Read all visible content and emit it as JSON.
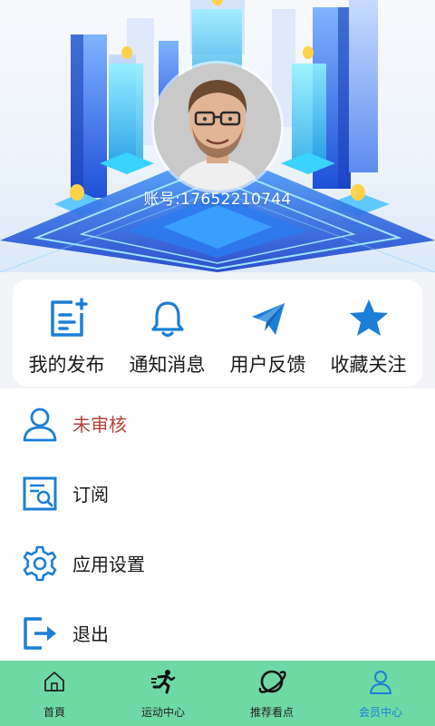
{
  "profile": {
    "account_text": "账号:17652210744"
  },
  "quick_actions": [
    {
      "label": "我的发布",
      "icon": "edit-document-icon"
    },
    {
      "label": "通知消息",
      "icon": "bell-icon"
    },
    {
      "label": "用户反馈",
      "icon": "paper-plane-icon"
    },
    {
      "label": "收藏关注",
      "icon": "star-icon"
    }
  ],
  "menu": [
    {
      "label": "未审核",
      "icon": "user-icon",
      "status": true
    },
    {
      "label": "订阅",
      "icon": "search-document-icon"
    },
    {
      "label": "应用设置",
      "icon": "gear-icon"
    },
    {
      "label": "退出",
      "icon": "logout-icon"
    }
  ],
  "tabs": [
    {
      "label": "首頁",
      "icon": "home-icon"
    },
    {
      "label": "运动中心",
      "icon": "runner-icon"
    },
    {
      "label": "推荐看点",
      "icon": "planet-icon"
    },
    {
      "label": "会员中心",
      "icon": "member-icon",
      "active": true
    }
  ],
  "colors": {
    "accent_blue": "#1b7fd6",
    "status_red": "#b5443a",
    "tabbar_green": "#6fd9a5"
  }
}
